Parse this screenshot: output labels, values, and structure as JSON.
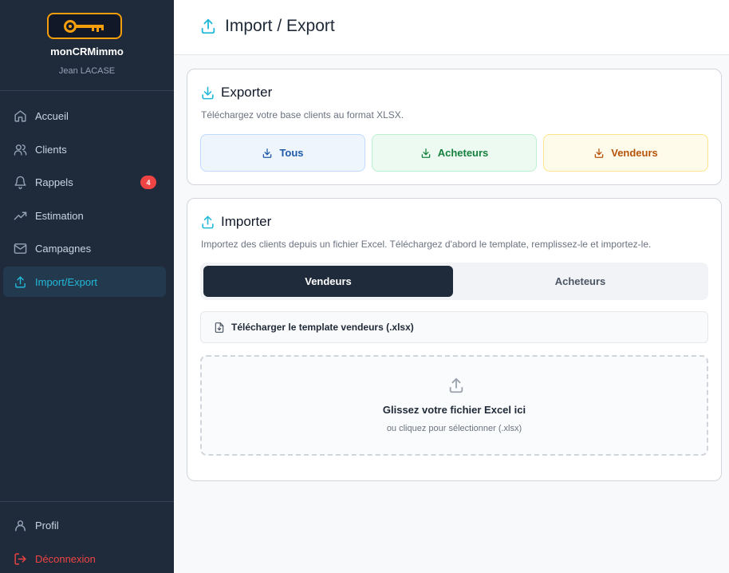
{
  "brand": {
    "app_name": "monCRMimmo",
    "user_name": "Jean LACASE"
  },
  "sidebar": {
    "items": [
      {
        "label": "Accueil",
        "icon": "home-icon"
      },
      {
        "label": "Clients",
        "icon": "users-icon"
      },
      {
        "label": "Rappels",
        "icon": "bell-icon",
        "badge": "4"
      },
      {
        "label": "Estimation",
        "icon": "trending-up-icon"
      },
      {
        "label": "Campagnes",
        "icon": "mail-icon"
      },
      {
        "label": "Import/Export",
        "icon": "upload-icon",
        "active": true
      }
    ],
    "bottom": [
      {
        "label": "Profil",
        "icon": "user-icon"
      },
      {
        "label": "Déconnexion",
        "icon": "logout-icon"
      }
    ]
  },
  "header": {
    "title": "Import / Export"
  },
  "export_card": {
    "title": "Exporter",
    "description": "Téléchargez votre base clients au format XLSX.",
    "buttons": {
      "all": "Tous",
      "buyers": "Acheteurs",
      "sellers": "Vendeurs"
    }
  },
  "import_card": {
    "title": "Importer",
    "description": "Importez des clients depuis un fichier Excel. Téléchargez d'abord le template, remplissez-le et importez-le.",
    "tabs": {
      "sellers": "Vendeurs",
      "buyers": "Acheteurs"
    },
    "active_tab": "Vendeurs",
    "template_link": "Télécharger le template vendeurs (.xlsx)",
    "dropzone": {
      "title": "Glissez votre fichier Excel ici",
      "subtitle": "ou cliquez pour sélectionner (.xlsx)"
    }
  },
  "colors": {
    "sidebar_bg": "#1f2a3a",
    "accent": "#22b8d8",
    "brand_orange": "#f59e0b",
    "badge_red": "#ef4444"
  }
}
